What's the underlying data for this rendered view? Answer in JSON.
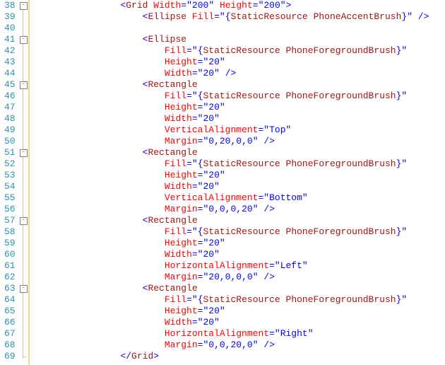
{
  "firstLine": 38,
  "code": {
    "indentUnit": "    ",
    "gridIndent": 4,
    "childIndent": 5,
    "attrIndent": 6,
    "foldables": [
      38,
      41,
      45,
      51,
      57,
      63
    ],
    "root": {
      "tag": "Grid",
      "openAttrs": [
        {
          "name": "Width",
          "value": "200",
          "type": "literal"
        },
        {
          "name": "Height",
          "value": "200",
          "type": "literal"
        }
      ],
      "children": [
        {
          "tag": "Ellipse",
          "inline": true,
          "attrs": [
            {
              "name": "Fill",
              "value": "PhoneAccentBrush",
              "type": "resource"
            }
          ]
        },
        {
          "blank": true
        },
        {
          "tag": "Ellipse",
          "attrs": [
            {
              "name": "Fill",
              "value": "PhoneForegroundBrush",
              "type": "resource"
            },
            {
              "name": "Height",
              "value": "20",
              "type": "literal"
            },
            {
              "name": "Width",
              "value": "20",
              "type": "literal"
            }
          ]
        },
        {
          "tag": "Rectangle",
          "attrs": [
            {
              "name": "Fill",
              "value": "PhoneForegroundBrush",
              "type": "resource"
            },
            {
              "name": "Height",
              "value": "20",
              "type": "literal"
            },
            {
              "name": "Width",
              "value": "20",
              "type": "literal"
            },
            {
              "name": "VerticalAlignment",
              "value": "Top",
              "type": "literal"
            },
            {
              "name": "Margin",
              "value": "0,20,0,0",
              "type": "literal"
            }
          ]
        },
        {
          "tag": "Rectangle",
          "attrs": [
            {
              "name": "Fill",
              "value": "PhoneForegroundBrush",
              "type": "resource"
            },
            {
              "name": "Height",
              "value": "20",
              "type": "literal"
            },
            {
              "name": "Width",
              "value": "20",
              "type": "literal"
            },
            {
              "name": "VerticalAlignment",
              "value": "Bottom",
              "type": "literal"
            },
            {
              "name": "Margin",
              "value": "0,0,0,20",
              "type": "literal"
            }
          ]
        },
        {
          "tag": "Rectangle",
          "attrs": [
            {
              "name": "Fill",
              "value": "PhoneForegroundBrush",
              "type": "resource"
            },
            {
              "name": "Height",
              "value": "20",
              "type": "literal"
            },
            {
              "name": "Width",
              "value": "20",
              "type": "literal"
            },
            {
              "name": "HorizontalAlignment",
              "value": "Left",
              "type": "literal"
            },
            {
              "name": "Margin",
              "value": "20,0,0,0",
              "type": "literal"
            }
          ]
        },
        {
          "tag": "Rectangle",
          "attrs": [
            {
              "name": "Fill",
              "value": "PhoneForegroundBrush",
              "type": "resource"
            },
            {
              "name": "Height",
              "value": "20",
              "type": "literal"
            },
            {
              "name": "Width",
              "value": "20",
              "type": "literal"
            },
            {
              "name": "HorizontalAlignment",
              "value": "Right",
              "type": "literal"
            },
            {
              "name": "Margin",
              "value": "0,0,20,0",
              "type": "literal"
            }
          ]
        }
      ]
    },
    "strings": {
      "staticResource": "StaticResource"
    }
  }
}
